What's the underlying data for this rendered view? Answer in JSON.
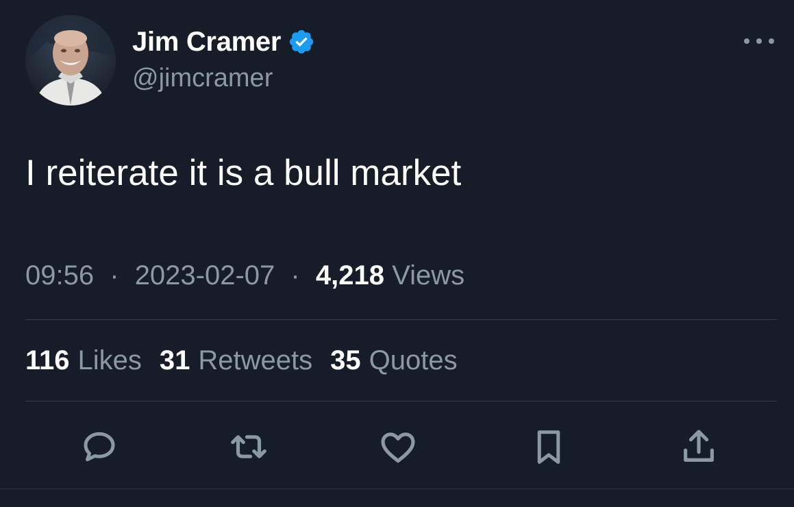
{
  "author": {
    "display_name": "Jim Cramer",
    "handle": "@jimcramer",
    "verified": true
  },
  "tweet": {
    "text": "I reiterate it is a bull market"
  },
  "meta": {
    "time": "09:56",
    "separator": "·",
    "date": "2023-02-07",
    "views_count": "4,218",
    "views_label": "Views"
  },
  "stats": {
    "likes_count": "116",
    "likes_label": "Likes",
    "retweets_count": "31",
    "retweets_label": "Retweets",
    "quotes_count": "35",
    "quotes_label": "Quotes"
  },
  "icons": {
    "more": "more-horizontal-icon",
    "reply": "reply-icon",
    "retweet": "retweet-icon",
    "like": "heart-icon",
    "bookmark": "bookmark-icon",
    "share": "share-icon",
    "verified": "verified-badge-icon"
  },
  "colors": {
    "background": "#161d28",
    "verified_blue": "#1d9bf0",
    "secondary_text": "#8b98a5",
    "primary_text": "#ffffff"
  }
}
